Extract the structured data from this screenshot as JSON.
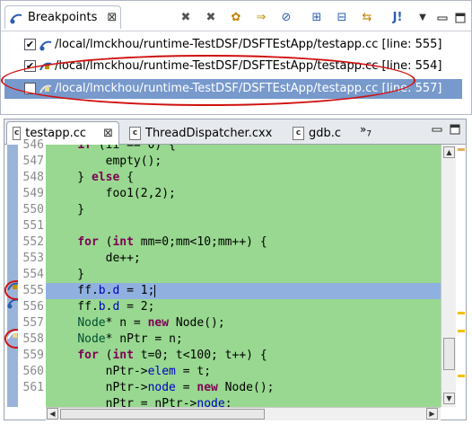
{
  "breakpoints_view": {
    "tab_title": "Breakpoints",
    "toolbar_icons": [
      "remove-icon",
      "remove-all-icon",
      "show-supported-icon",
      "goto-file-icon",
      "skip-all-icon",
      "expand-all-icon",
      "collapse-all-icon",
      "link-editor-icon",
      "add-java-exception-icon",
      "view-menu-icon",
      "minimize-icon",
      "maximize-icon"
    ],
    "rows": [
      {
        "checked": true,
        "label": "/local/lmckhou/runtime-TestDSF/DSFTEstApp/testapp.cc [line: 555]",
        "selected": false
      },
      {
        "checked": true,
        "label": "/local/lmckhou/runtime-TestDSF/DSFTEstApp/testapp.cc [line: 554]",
        "selected": false
      },
      {
        "checked": false,
        "label": "/local/lmckhou/runtime-TestDSF/DSFTEstApp/testapp.cc [line: 557]",
        "selected": true
      }
    ]
  },
  "editor": {
    "tabs": [
      {
        "label": "testapp.cc",
        "active": true
      },
      {
        "label": "ThreadDispatcher.cxx",
        "active": false
      },
      {
        "label": "gdb.c",
        "active": false
      }
    ],
    "overflow_count": "7",
    "line_numbers": [
      "546",
      "547",
      "548",
      "549",
      "550",
      "551",
      "552",
      "553",
      "554",
      "555",
      "556",
      "557",
      "558",
      "559",
      "560",
      "561"
    ],
    "highlighted_line": "554"
  },
  "colors": {
    "code_background": "#98d890",
    "selection": "#7799cc",
    "annotation": "#d01010",
    "keyword": "#7f0055"
  }
}
